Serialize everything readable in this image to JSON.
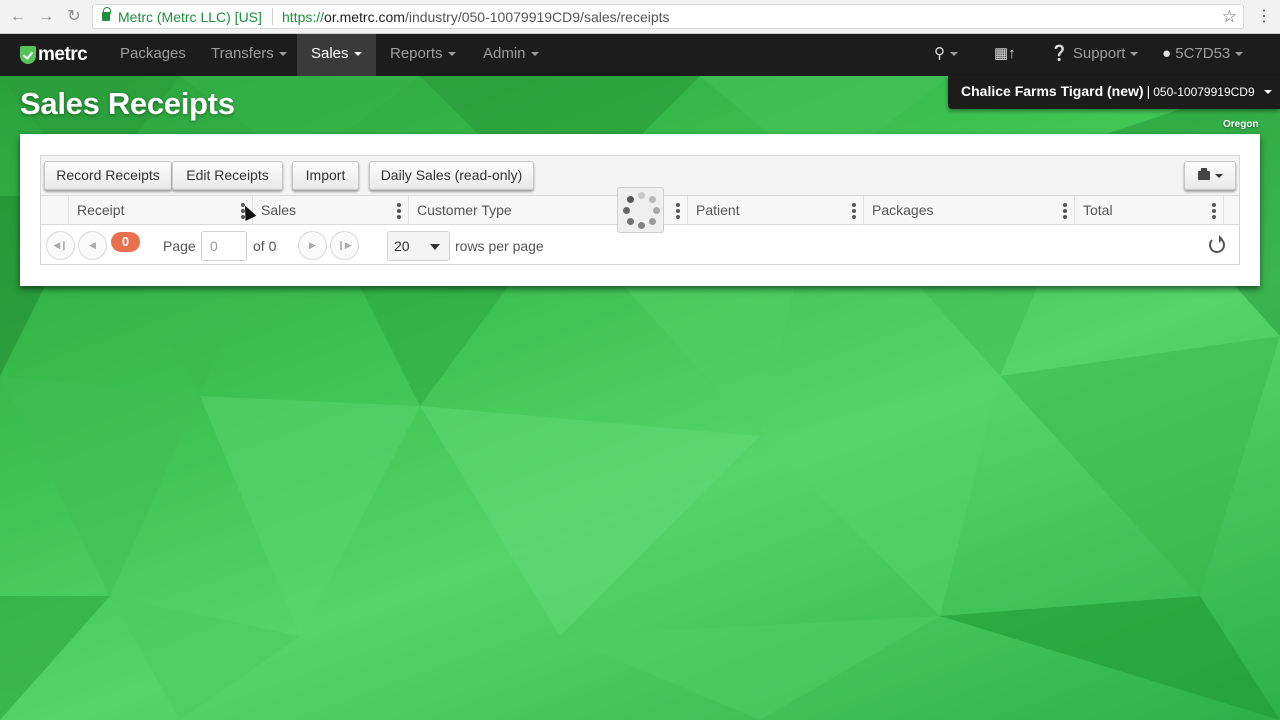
{
  "browser": {
    "site_identity": "Metrc (Metrc LLC) [US]",
    "url_scheme": "https://",
    "url_host": "or.metrc.com",
    "url_path": "/industry/050-10079919CD9/sales/receipts"
  },
  "navbar": {
    "brand": "metrc",
    "items": [
      {
        "label": "Packages"
      },
      {
        "label": "Transfers"
      },
      {
        "label": "Sales"
      },
      {
        "label": "Reports"
      },
      {
        "label": "Admin"
      }
    ],
    "support_label": "Support",
    "user_label": "5C7D53",
    "icons": [
      "search-icon",
      "file-upload-icon",
      "question-circle-icon",
      "user-icon"
    ]
  },
  "page": {
    "title": "Sales Receipts",
    "facility_name": "Chalice Farms Tigard (new)",
    "facility_separator": "|",
    "facility_license": "050-10079919CD9",
    "state": "Oregon"
  },
  "toolbar": {
    "record_receipts": "Record Receipts",
    "edit_receipts": "Edit Receipts",
    "import": "Import",
    "daily_sales": "Daily Sales (read-only)"
  },
  "columns": [
    {
      "label": "Receipt"
    },
    {
      "label": "Sales"
    },
    {
      "label": "Customer Type"
    },
    {
      "label": "Patient"
    },
    {
      "label": "Packages"
    },
    {
      "label": "Total"
    }
  ],
  "pager": {
    "count": "0",
    "page_label": "Page",
    "page_value": "0",
    "of_label": "of 0",
    "rows_value": "20",
    "rows_label": "rows per page"
  },
  "colors": {
    "navbar": "#1c1c1c",
    "brand_green": "#57c25a",
    "badge": "#e8704e"
  }
}
